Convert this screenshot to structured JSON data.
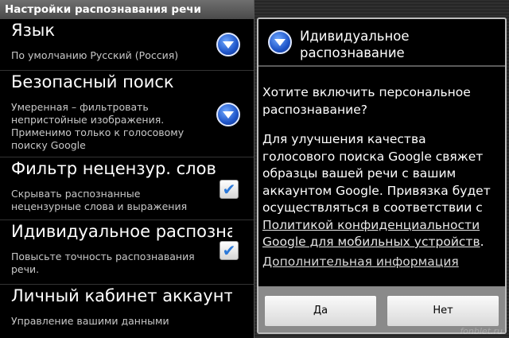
{
  "settings": {
    "title": "Настройки распознавания речи",
    "items": [
      {
        "title": "Язык",
        "summary": "По умолчанию Русский (Россия)",
        "control": "chevron-down-icon"
      },
      {
        "title": "Безопасный поиск",
        "summary": "Умеренная – фильтровать непристойные изображения. Применимо только к голосовому поиску Google",
        "control": "chevron-down-icon"
      },
      {
        "title": "Фильтр нецензур. слов",
        "summary": "Скрывать распознанные нецензурные слова и выражения",
        "checked": true
      },
      {
        "title": "Идивидуальное распознавание",
        "summary": "Повысьте точность распознавания речи.",
        "checked": true
      },
      {
        "title": "Личный кабинет аккаунта Google",
        "summary": "Управление вашими данными"
      }
    ]
  },
  "dialog": {
    "title": "Идивидуальное распознавание",
    "question": "Хотите включить персональное распознавание?",
    "body": "Для улучшения качества голосового поиска Google свяжет образцы вашей речи с вашим аккаунтом Google. Привязка будет осуществляться в соответствии с ",
    "link": "Политикой конфиденциальности Google для мобильных устройств",
    "body_end": ".",
    "more_info": "Дополнительная информация",
    "yes": "Да",
    "no": "Нет"
  },
  "watermark": "fonblet.ru",
  "colors": {
    "accent": "#1f55c8",
    "check": "#2c79d8"
  }
}
